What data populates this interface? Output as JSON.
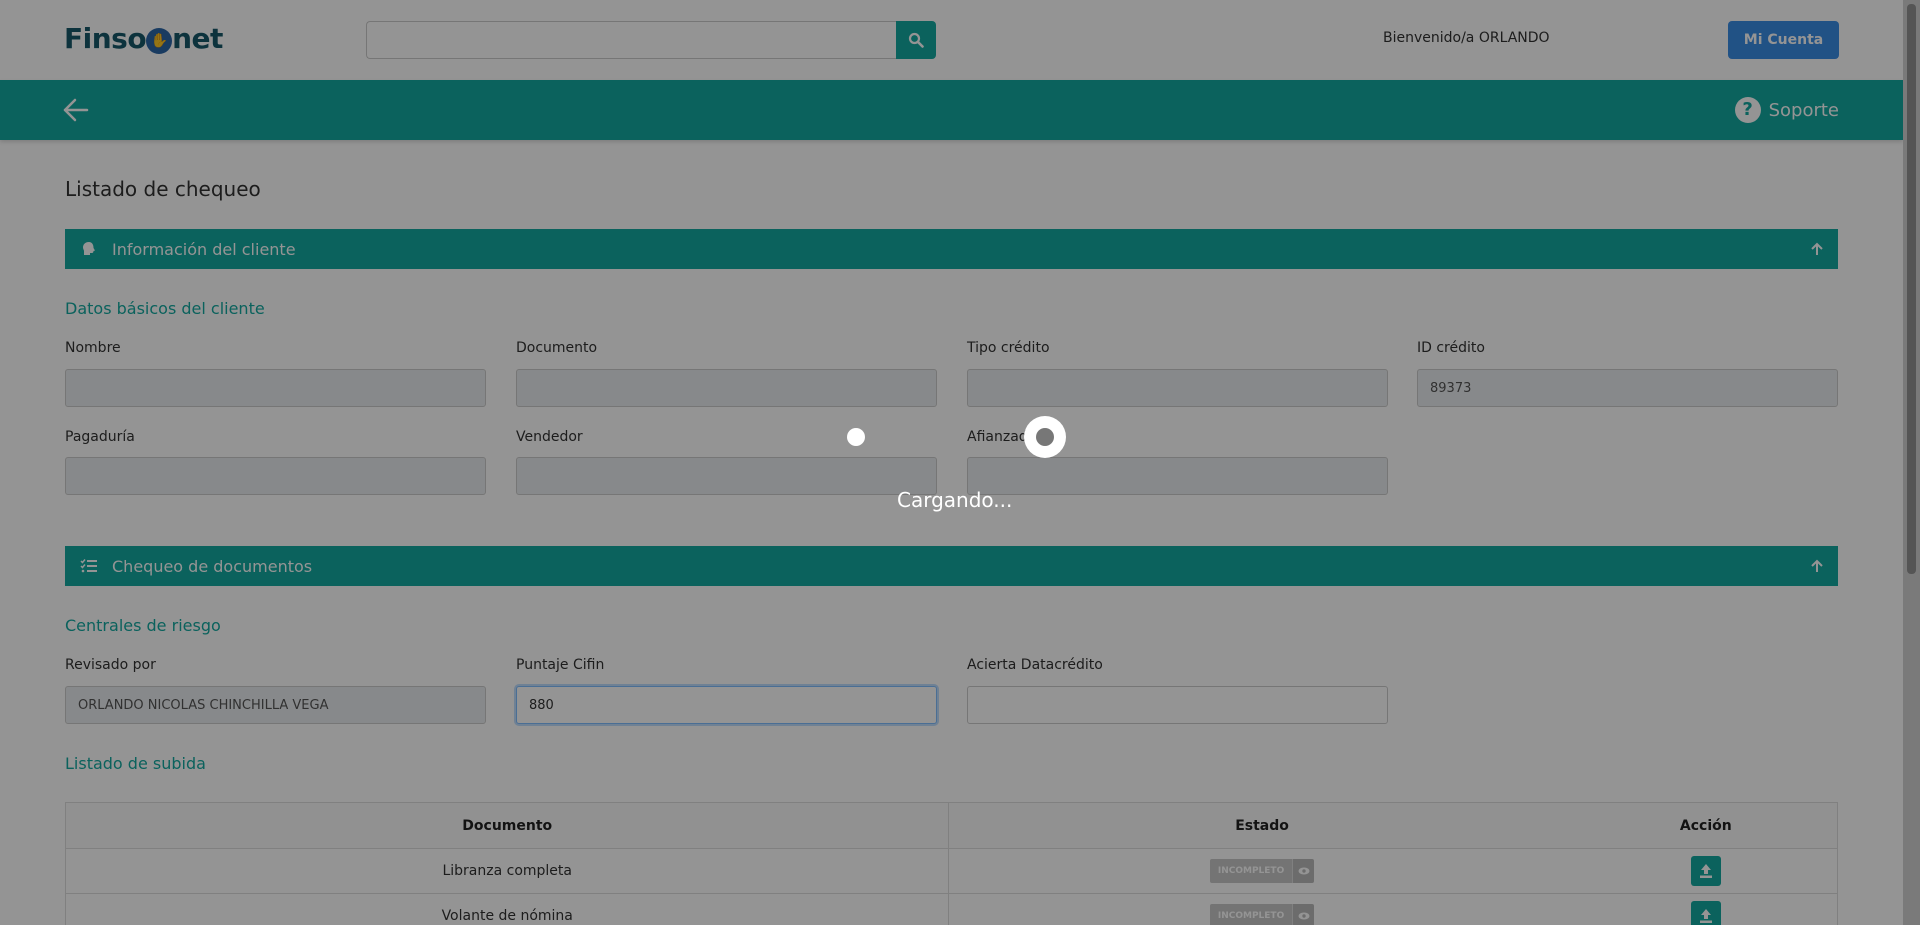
{
  "header": {
    "logo_text_1": "Finso",
    "logo_text_2": "net",
    "search_placeholder": "",
    "welcome": "Bienvenido/a ORLANDO",
    "account_button": "Mi Cuenta"
  },
  "nav": {
    "support_label": "Soporte"
  },
  "page": {
    "title": "Listado de chequeo"
  },
  "client_section": {
    "bar_title": "Información del cliente",
    "subheading": "Datos básicos del cliente",
    "fields": [
      {
        "label": "Nombre",
        "value": ""
      },
      {
        "label": "Documento",
        "value": ""
      },
      {
        "label": "Tipo crédito",
        "value": ""
      },
      {
        "label": "ID crédito",
        "value": "89373"
      },
      {
        "label": "Pagaduría",
        "value": ""
      },
      {
        "label": "Vendedor",
        "value": ""
      },
      {
        "label": "Afianzad",
        "value": ""
      }
    ]
  },
  "docs_section": {
    "bar_title": "Chequeo de documentos",
    "risk_heading": "Centrales de riesgo",
    "fields": [
      {
        "label": "Revisado por",
        "value": "ORLANDO NICOLAS CHINCHILLA VEGA"
      },
      {
        "label": "Puntaje Cifin",
        "value": "880"
      },
      {
        "label": "Acierta Datacrédito",
        "value": ""
      }
    ],
    "upload_heading": "Listado de subida",
    "table": {
      "headers": [
        "Documento",
        "Estado",
        "Acción"
      ],
      "rows": [
        {
          "documento": "Libranza completa",
          "estado": "INCOMPLETO"
        },
        {
          "documento": "Volante de nómina",
          "estado": "INCOMPLETO"
        }
      ]
    }
  },
  "overlay": {
    "loading_text": "Cargando..."
  },
  "colors": {
    "primary": "#14a9a0",
    "account_button": "#3a8ee6",
    "logo": "#17586a"
  }
}
